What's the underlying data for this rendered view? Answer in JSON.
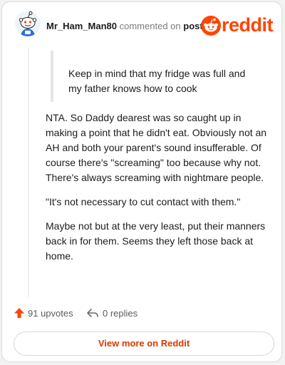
{
  "header": {
    "username": "Mr_Ham_Man80",
    "action_text": "commented on",
    "target_link": "post",
    "brand_name": "reddit",
    "brand_color": "#ff4500"
  },
  "comment": {
    "quote": "Keep in mind that my fridge was full and my father knows how to cook",
    "paragraphs": [
      "NTA. So Daddy dearest was so caught up in making a point that he didn't eat. Obviously not an AH and both your parent's sound insufferable. Of course there's \"screaming\" too because why not. There's always screaming with nightmare people.",
      "\"It's not necessary to cut contact with them.\"",
      "Maybe not but at the very least, put their manners back in for them. Seems they left those back at home."
    ]
  },
  "actions": {
    "upvotes": "91 upvotes",
    "replies": "0 replies",
    "upvote_icon": "upvote-arrow-icon",
    "reply_icon": "reply-arrow-icon"
  },
  "footer": {
    "view_more": "View more on Reddit",
    "accent": "#d93a00"
  }
}
